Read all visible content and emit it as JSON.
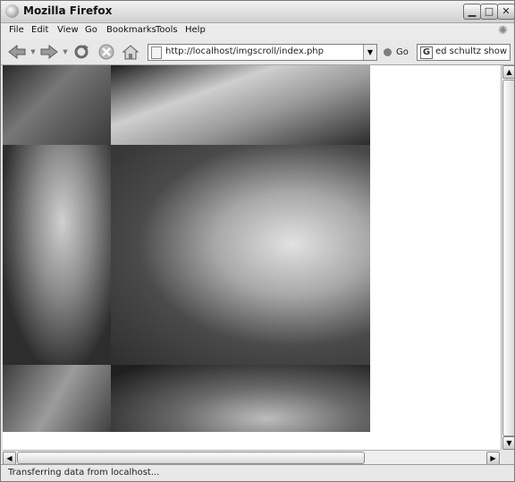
{
  "window": {
    "title": "Mozilla Firefox",
    "controls": {
      "minimize": "▁",
      "maximize": "□",
      "close": "✕"
    }
  },
  "menu": {
    "items": [
      {
        "label": "File"
      },
      {
        "label": "Edit"
      },
      {
        "label": "View"
      },
      {
        "label": "Go"
      },
      {
        "label": "Bookmarks"
      },
      {
        "label": "Tools"
      },
      {
        "label": "Help"
      }
    ]
  },
  "navbar": {
    "icons": [
      "back-icon",
      "forward-icon",
      "reload-icon",
      "stop-icon",
      "home-icon"
    ],
    "url": "http://localhost/imgscroll/index.php",
    "go_label": "Go",
    "search_value": "ed schultz show",
    "search_engine_glyph": "G"
  },
  "content": {
    "background": "#ffffff",
    "photos": [
      {
        "name": "photo-top-left",
        "tone": "#3a3a3a"
      },
      {
        "name": "photo-top-right",
        "tone": "#5a5a5a"
      },
      {
        "name": "photo-middle-left",
        "tone": "#454545"
      },
      {
        "name": "photo-middle-right",
        "tone": "#5e5e5e"
      },
      {
        "name": "photo-bottom-left",
        "tone": "#4a4a4a"
      },
      {
        "name": "photo-bottom-right",
        "tone": "#3f3f3f"
      }
    ]
  },
  "status": {
    "text": "Transferring data from localhost..."
  }
}
